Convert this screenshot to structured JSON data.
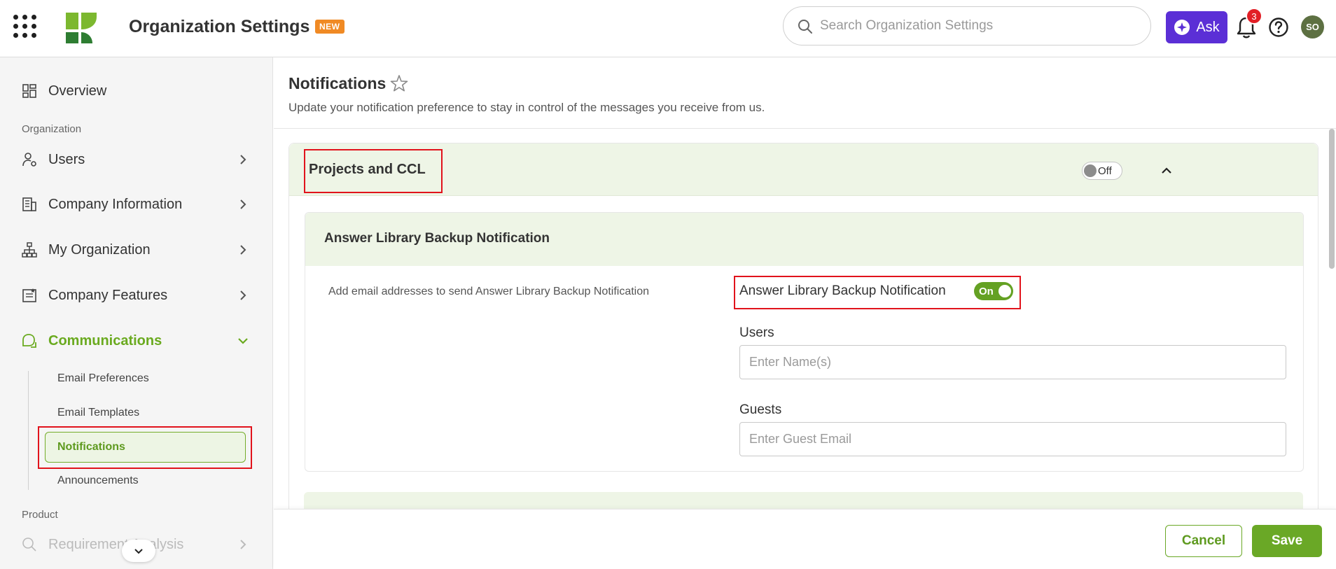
{
  "header": {
    "app_title": "Organization Settings",
    "new_badge": "NEW",
    "search_placeholder": "Search Organization Settings",
    "ask_label": "Ask",
    "notification_count": "3",
    "avatar_initials": "SO"
  },
  "sidebar": {
    "overview": "Overview",
    "section_organization": "Organization",
    "items": [
      {
        "label": "Users"
      },
      {
        "label": "Company Information"
      },
      {
        "label": "My Organization"
      },
      {
        "label": "Company Features"
      },
      {
        "label": "Communications"
      }
    ],
    "sub_items": [
      {
        "label": "Email Preferences"
      },
      {
        "label": "Email Templates"
      },
      {
        "label": "Notifications"
      },
      {
        "label": "Announcements"
      }
    ],
    "section_product": "Product",
    "requirement_analysis": "Requirement Analysis"
  },
  "page": {
    "title": "Notifications",
    "description": "Update your notification preference to stay in control of the messages you receive from us."
  },
  "panel": {
    "title": "Projects and CCL",
    "toggle_label": "Off",
    "card": {
      "title": "Answer Library Backup Notification",
      "description": "Add email addresses to send Answer Library Backup Notification",
      "toggle_text": "Answer Library Backup Notification",
      "toggle_label": "On",
      "users_label": "Users",
      "users_placeholder": "Enter Name(s)",
      "guests_label": "Guests",
      "guests_placeholder": "Enter Guest Email"
    }
  },
  "footer": {
    "cancel_label": "Cancel",
    "save_label": "Save"
  },
  "colors": {
    "accent_green": "#6aa826",
    "ask_purple": "#5b2fd6",
    "highlight_red": "#e1131c",
    "panel_bg": "#eef5e6",
    "new_badge_orange": "#f08a24"
  },
  "icons": [
    "apps-grid-icon",
    "logo",
    "search-icon",
    "sparkle-icon",
    "bell-icon",
    "help-icon",
    "overview-icon",
    "users-icon",
    "building-icon",
    "org-chart-icon",
    "features-icon",
    "chat-icon",
    "chevron-right-icon",
    "chevron-down-icon",
    "star-icon",
    "chevron-up-icon"
  ]
}
